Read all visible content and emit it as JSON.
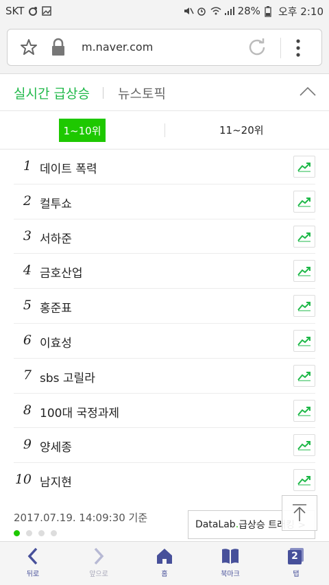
{
  "status_bar": {
    "carrier": "SKT",
    "battery": "28%",
    "time": "오후 2:10"
  },
  "browser": {
    "url": "m.naver.com"
  },
  "section": {
    "tab_active": "실시간 급상승",
    "tab_inactive": "뉴스토픽"
  },
  "rank_tabs": {
    "active": "1~10위",
    "inactive": "11~20위"
  },
  "rankings": [
    {
      "rank": "1",
      "keyword": "데이트 폭력"
    },
    {
      "rank": "2",
      "keyword": "컬투쇼"
    },
    {
      "rank": "3",
      "keyword": "서하준"
    },
    {
      "rank": "4",
      "keyword": "금호산업"
    },
    {
      "rank": "5",
      "keyword": "홍준표"
    },
    {
      "rank": "6",
      "keyword": "이효성"
    },
    {
      "rank": "7",
      "keyword": "sbs 고릴라"
    },
    {
      "rank": "8",
      "keyword": "100대 국정과제"
    },
    {
      "rank": "9",
      "keyword": "양세종"
    },
    {
      "rank": "10",
      "keyword": "남지현"
    }
  ],
  "footer": {
    "timestamp": "2017.07.19. 14:09:30 기준",
    "datalab_brand": "DataLab",
    "datalab_dot": ".",
    "datalab_text": "급상승 트래킹 >"
  },
  "bottom_nav": {
    "back": "뒤로",
    "forward": "앞으로",
    "home": "홈",
    "bookmarks": "북마크",
    "tabs": "탭",
    "tab_count": "2"
  },
  "colors": {
    "accent_green": "#1ec800",
    "nav_purple": "#47509a"
  }
}
